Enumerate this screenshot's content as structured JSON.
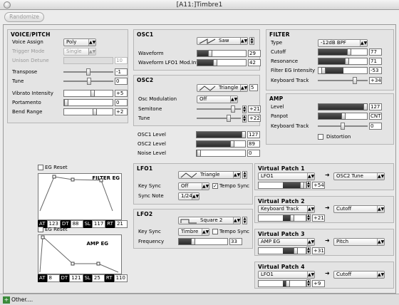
{
  "window": {
    "title": "[A11:]Timbre1"
  },
  "toolbar": {
    "randomize_label": "Randomize"
  },
  "voice": {
    "title": "VOICE/PITCH",
    "voice_assign_label": "Voice Assign",
    "voice_assign": "Poly",
    "trigger_mode_label": "Trigger Mode",
    "trigger_mode": "Single",
    "unison_detune_label": "Unison Detune",
    "unison_detune": "10",
    "transpose_label": "Transpose",
    "transpose": "-1",
    "tune_label": "Tune",
    "tune": "0",
    "vibrato_label": "Vibrato Intensity",
    "vibrato": "+5",
    "portamento_label": "Portamento",
    "portamento": "0",
    "bend_label": "Bend Range",
    "bend": "+2"
  },
  "osc1": {
    "title": "OSC1",
    "wave": "Saw",
    "waveform_label": "Waveform",
    "waveform": "29",
    "lfo_mod_label": "Waveform LFO1 Mod.Int",
    "lfo_mod": "42"
  },
  "osc2": {
    "title": "OSC2",
    "wave": "Triangle",
    "wave_num": "5",
    "osc_mod_label": "Osc Modulation",
    "osc_mod": "Off",
    "semitone_label": "Semitone",
    "semitone": "+21",
    "tune_label": "Tune",
    "tune": "+22"
  },
  "mixer": {
    "osc1_label": "OSC1 Level",
    "osc1": "127",
    "osc2_label": "OSC2 Level",
    "osc2": "89",
    "noise_label": "Noise Level",
    "noise": "0"
  },
  "filter": {
    "title": "FILTER",
    "type_label": "Type",
    "type": "-12dB BPF",
    "cutoff_label": "Cutoff",
    "cutoff": "77",
    "resonance_label": "Resonance",
    "resonance": "71",
    "eg_int_label": "Filter EG Intensity",
    "eg_int": "-53",
    "kbd_track_label": "Keyboard Track",
    "kbd_track": "+34"
  },
  "amp": {
    "title": "AMP",
    "level_label": "Level",
    "level": "127",
    "panpot_label": "Panpot",
    "panpot": "CNT",
    "kbd_track_label": "Keyboard Track",
    "kbd_track": "0",
    "distortion_label": "Distortion"
  },
  "filter_eg": {
    "title": "FILTER EG",
    "reset_label": "EG Reset",
    "at_label": "AT",
    "at": "123",
    "dt_label": "DT",
    "dt": "88",
    "sl_label": "SL",
    "sl": "117",
    "rt_label": "RT",
    "rt": "21"
  },
  "amp_eg": {
    "title": "AMP EG",
    "reset_label": "EG Reset",
    "at_label": "AT",
    "at": "8",
    "dt_label": "DT",
    "dt": "121",
    "sl_label": "SL",
    "sl": "25",
    "rt_label": "RT",
    "rt": "110"
  },
  "lfo1": {
    "title": "LFO1",
    "wave": "Triangle",
    "key_sync_label": "Key Sync",
    "key_sync": "Off",
    "tempo_sync_label": "Tempo Sync",
    "sync_note_label": "Sync Note",
    "sync_note": "1/24"
  },
  "lfo2": {
    "title": "LFO2",
    "wave": "Square 2",
    "key_sync_label": "Key Sync",
    "key_sync": "Timbre",
    "tempo_sync_label": "Tempo Sync",
    "freq_label": "Frequency",
    "freq": "33"
  },
  "vp1": {
    "title": "Virtual Patch 1",
    "source": "LFO1",
    "amount": "+54",
    "dest": "OSC2 Tune"
  },
  "vp2": {
    "title": "Virtual Patch 2",
    "source": "Keyboard Track",
    "amount": "+21",
    "dest": "Cutoff"
  },
  "vp3": {
    "title": "Virtual Patch 3",
    "source": "AMP EG",
    "amount": "+31",
    "dest": "Pitch"
  },
  "vp4": {
    "title": "Virtual Patch 4",
    "source": "LFO1",
    "amount": "+9",
    "dest": "Cutoff"
  },
  "footer": {
    "other_label": "Other...."
  },
  "colors": {
    "window_bg": "#ececec",
    "fill_dark": "#2b2b2b",
    "other_green": "#3a8a3a"
  }
}
